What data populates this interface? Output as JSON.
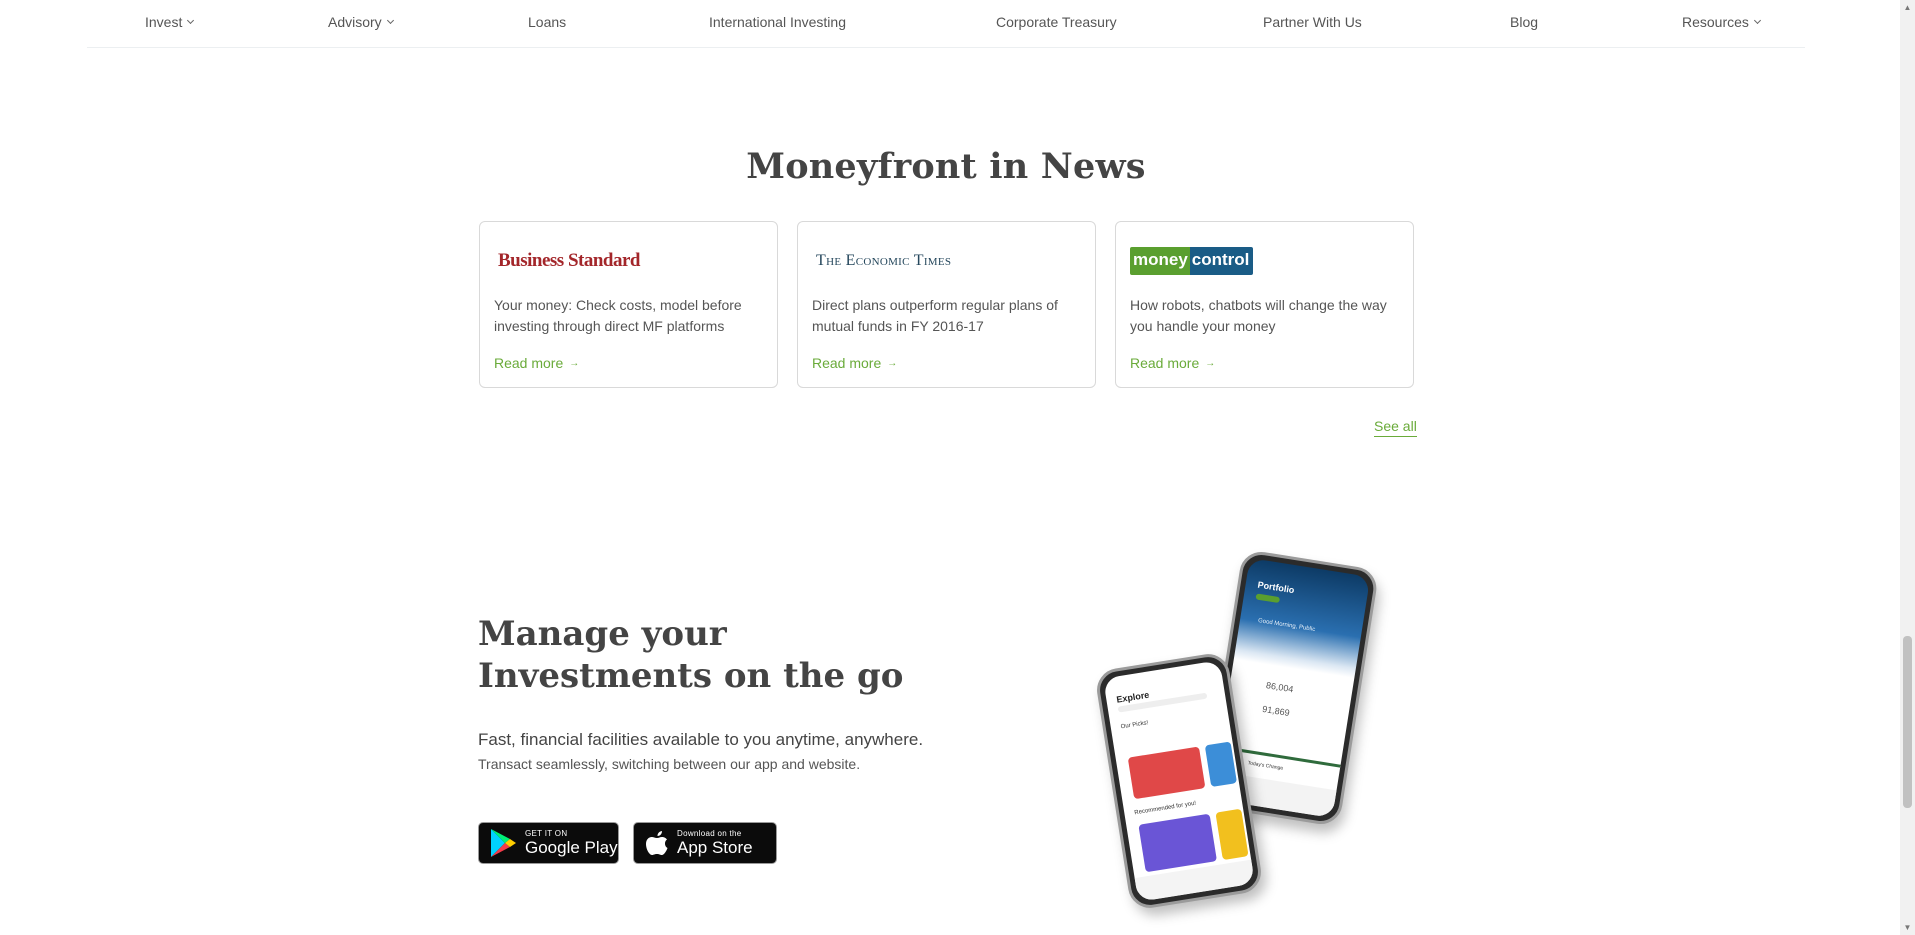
{
  "nav": {
    "items": [
      {
        "label": "Invest",
        "has_menu": true
      },
      {
        "label": "Advisory",
        "has_menu": true
      },
      {
        "label": "Loans",
        "has_menu": false
      },
      {
        "label": "International Investing",
        "has_menu": false
      },
      {
        "label": "Corporate Treasury",
        "has_menu": false
      },
      {
        "label": "Partner With Us",
        "has_menu": false
      },
      {
        "label": "Blog",
        "has_menu": false
      },
      {
        "label": "Resources",
        "has_menu": true
      }
    ]
  },
  "news": {
    "title": "Moneyfront in News",
    "cards": [
      {
        "source": "Business Standard",
        "headline": "Your money: Check costs, model before investing through direct MF platforms",
        "link_label": "Read more"
      },
      {
        "source": "The Economic Times",
        "headline": "Direct plans outperform regular plans of mutual funds in FY 2016-17",
        "link_label": "Read more"
      },
      {
        "source_part1": "money",
        "source_part2": "control",
        "headline": "How robots, chatbots will change the way you handle your money",
        "link_label": "Read more"
      }
    ],
    "see_all_label": "See all"
  },
  "app": {
    "title": "Manage your Investments on the go",
    "subtitle": "Fast, financial facilities available to you anytime, anywhere.",
    "description": "Transact seamlessly, switching between our app and website.",
    "google_play": {
      "small": "GET IT ON",
      "big": "Google Play"
    },
    "app_store": {
      "small": "Download on the",
      "big": "App Store"
    },
    "phone_back": {
      "header": "Portfolio",
      "greeting": "Good Morning, Public",
      "value1": "86,004",
      "value2": "91,869",
      "change": "Today's Change"
    },
    "phone_front": {
      "header": "Explore",
      "section1": "Our Picks!",
      "section2": "Recommended for you!"
    }
  }
}
